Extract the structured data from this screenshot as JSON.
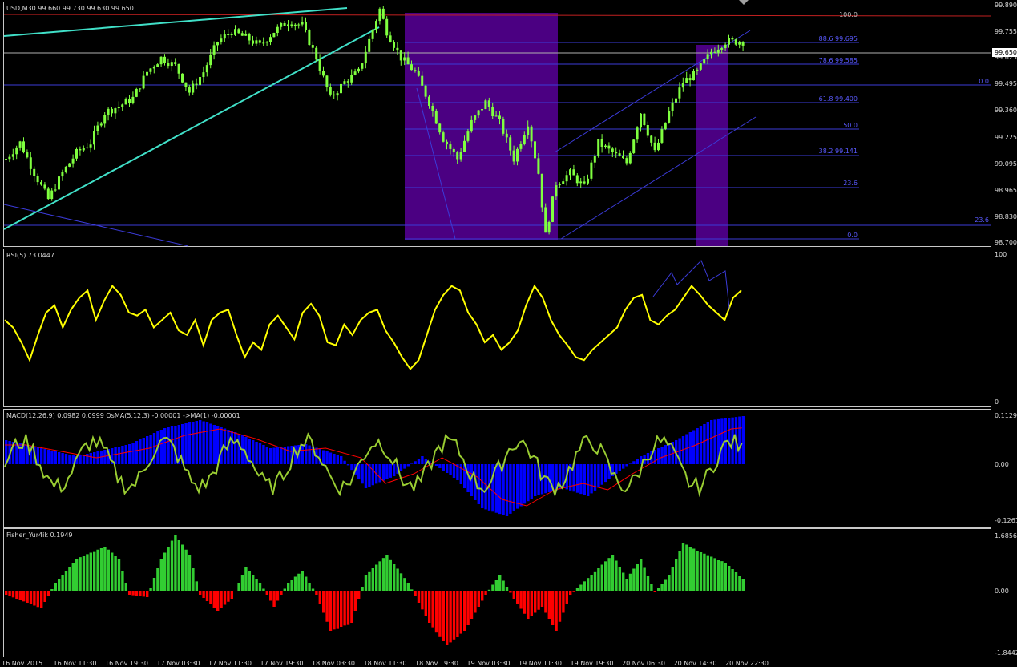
{
  "colors": {
    "background": "#000000",
    "frame": "#c8c8c8",
    "text": "#d8d8d8",
    "candle": "#7fff3f",
    "trendline": "#40e0c8",
    "level_line": "#3b3bd8",
    "fib_text": "#5a5aff",
    "red_line": "#c02020",
    "fib_box": "#4b0082",
    "rsi": "#ffff00",
    "macd_hist": "#0000ff",
    "macd_signal": "#ff0000",
    "macd_line": "#9acd32",
    "fisher_pos": "#32cd32",
    "fisher_neg": "#ff0000"
  },
  "main": {
    "title": "USD,M30  99.660 99.730 99.630 99.650",
    "current_price": "99.650",
    "price_ticks": [
      "99.890",
      "99.755",
      "99.625",
      "99.495",
      "99.360",
      "99.225",
      "99.095",
      "98.965",
      "98.830",
      "98.700"
    ],
    "fib_labels": [
      "100.0",
      "88.6 99.695",
      "78.6 99.585",
      "0.0",
      "61.8 99.400",
      "50.0",
      "38.2 99.141",
      "23.6",
      "23.6",
      "0.0"
    ]
  },
  "rsi": {
    "title": "RSI(5) 73.0447",
    "ticks": [
      "100",
      "0"
    ]
  },
  "macd": {
    "title": "MACD(12,26,9) 0.0982 0.0999  OsMA(5,12,3) -0.00001  ->MA(1) -0.00001",
    "ticks": [
      "0.1129",
      "0.00",
      "-0.1261"
    ]
  },
  "fisher": {
    "title": "Fisher_Yur4ik 0.1949",
    "ticks": [
      "1.6856",
      "0.00",
      "-1.8442"
    ]
  },
  "time_axis": [
    "16 Nov 2015",
    "16 Nov 11:30",
    "16 Nov 19:30",
    "17 Nov 03:30",
    "17 Nov 11:30",
    "17 Nov 19:30",
    "18 Nov 03:30",
    "18 Nov 11:30",
    "18 Nov 19:30",
    "19 Nov 03:30",
    "19 Nov 11:30",
    "19 Nov 19:30",
    "20 Nov 06:30",
    "20 Nov 14:30",
    "20 Nov 22:30"
  ],
  "chart_data": {
    "type": "line",
    "symbol": "USD",
    "timeframe": "M30",
    "ohlc_last": {
      "open": 99.66,
      "high": 99.73,
      "low": 99.63,
      "close": 99.65
    },
    "ylim": [
      98.7,
      99.89
    ],
    "price_path": [
      [
        0,
        99.12
      ],
      [
        4,
        99.2
      ],
      [
        8,
        99.05
      ],
      [
        12,
        98.92
      ],
      [
        16,
        99.05
      ],
      [
        20,
        99.15
      ],
      [
        24,
        99.2
      ],
      [
        28,
        99.35
      ],
      [
        32,
        99.38
      ],
      [
        36,
        99.42
      ],
      [
        40,
        99.55
      ],
      [
        44,
        99.62
      ],
      [
        48,
        99.58
      ],
      [
        52,
        99.45
      ],
      [
        56,
        99.55
      ],
      [
        60,
        99.7
      ],
      [
        64,
        99.75
      ],
      [
        68,
        99.72
      ],
      [
        72,
        99.68
      ],
      [
        76,
        99.75
      ],
      [
        80,
        99.8
      ],
      [
        84,
        99.78
      ],
      [
        88,
        99.62
      ],
      [
        92,
        99.42
      ],
      [
        96,
        99.5
      ],
      [
        100,
        99.55
      ],
      [
        104,
        99.76
      ],
      [
        106,
        99.86
      ],
      [
        108,
        99.75
      ],
      [
        112,
        99.62
      ],
      [
        116,
        99.55
      ],
      [
        120,
        99.4
      ],
      [
        124,
        99.22
      ],
      [
        128,
        99.12
      ],
      [
        132,
        99.3
      ],
      [
        136,
        99.4
      ],
      [
        140,
        99.3
      ],
      [
        144,
        99.12
      ],
      [
        148,
        99.3
      ],
      [
        151,
        99.05
      ],
      [
        153,
        98.74
      ],
      [
        156,
        99.0
      ],
      [
        160,
        99.05
      ],
      [
        164,
        98.98
      ],
      [
        168,
        99.2
      ],
      [
        172,
        99.15
      ],
      [
        176,
        99.1
      ],
      [
        180,
        99.35
      ],
      [
        184,
        99.15
      ],
      [
        188,
        99.35
      ],
      [
        192,
        99.5
      ],
      [
        196,
        99.55
      ],
      [
        200,
        99.65
      ],
      [
        204,
        99.7
      ]
    ],
    "fib_levels": [
      {
        "level": "88.6",
        "price": 99.695
      },
      {
        "level": "78.6",
        "price": 99.585
      },
      {
        "level": "61.8",
        "price": 99.4
      },
      {
        "level": "38.2",
        "price": 99.141
      }
    ],
    "rsi": {
      "name": "RSI(5)",
      "last": 73.0447,
      "ylim": [
        0,
        100
      ],
      "values": [
        55,
        50,
        40,
        28,
        45,
        60,
        65,
        50,
        62,
        70,
        75,
        55,
        68,
        78,
        72,
        60,
        58,
        62,
        50,
        55,
        60,
        48,
        45,
        55,
        38,
        55,
        60,
        62,
        45,
        30,
        40,
        35,
        52,
        58,
        50,
        42,
        60,
        66,
        58,
        40,
        38,
        52,
        45,
        55,
        60,
        62,
        48,
        40,
        30,
        22,
        28,
        45,
        62,
        72,
        78,
        75,
        60,
        52,
        40,
        45,
        35,
        40,
        48,
        65,
        78,
        70,
        55,
        45,
        38,
        30,
        28,
        35,
        40,
        45,
        50,
        62,
        70,
        72,
        55,
        52,
        58,
        62,
        70,
        78,
        72,
        65,
        60,
        55,
        70,
        75
      ]
    },
    "macd": {
      "name": "MACD(12,26,9)",
      "values": [
        0.0982,
        0.0999
      ],
      "osma": {
        "name": "OsMA(5,12,3)",
        "value": -1e-05
      },
      "ma": {
        "name": "->MA(1)",
        "value": -1e-05
      },
      "ylim": [
        -0.1261,
        0.1129
      ]
    },
    "fisher": {
      "name": "Fisher_Yur4ik",
      "last": 0.1949,
      "ylim": [
        -1.8442,
        1.6856
      ]
    }
  }
}
